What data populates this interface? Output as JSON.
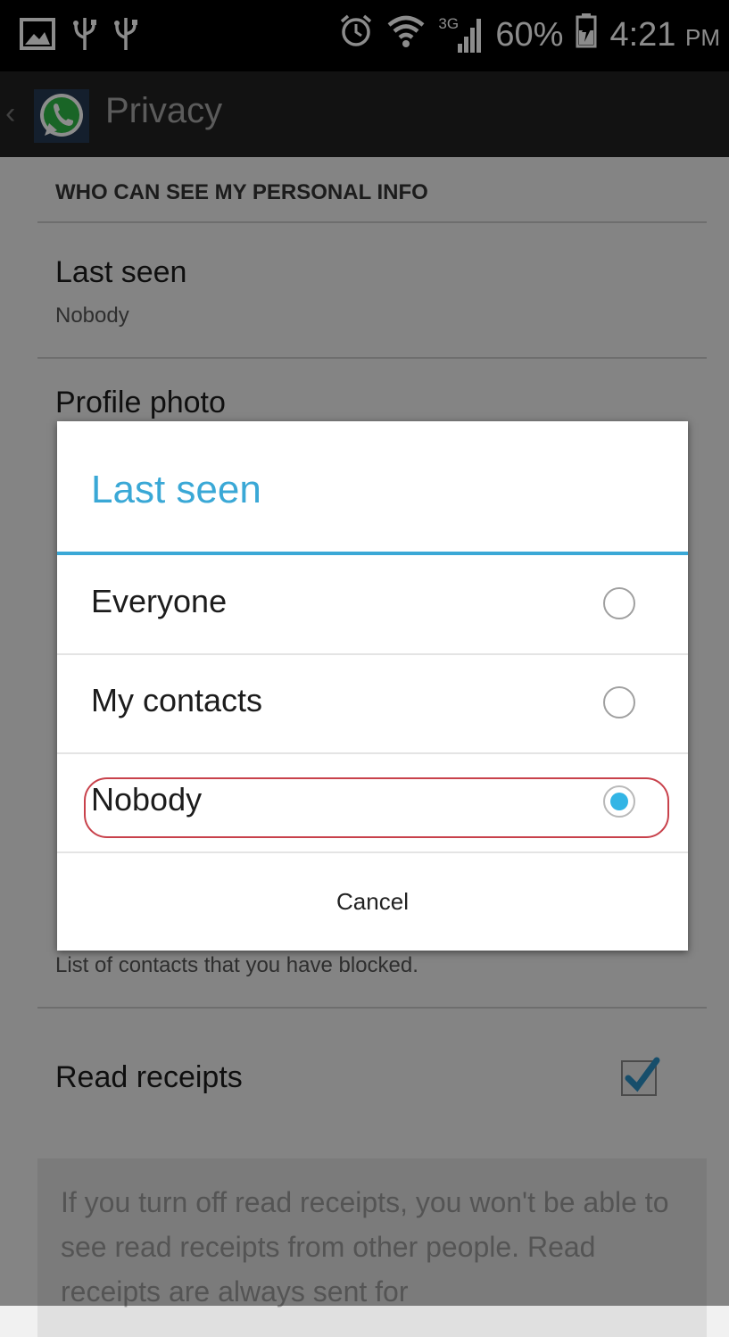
{
  "status_bar": {
    "icons_left": [
      "picture-icon",
      "usb-icon",
      "usb-icon"
    ],
    "network_type": "3G",
    "battery": "60%",
    "time": "4:21",
    "ampm": "PM"
  },
  "action_bar": {
    "title": "Privacy",
    "icon": "whatsapp-logo"
  },
  "settings": {
    "section_header": "WHO CAN SEE MY PERSONAL INFO",
    "last_seen": {
      "title": "Last seen",
      "value": "Nobody"
    },
    "profile_photo": {
      "title": "Profile photo"
    },
    "blocked_contacts": {
      "subtitle": "List of contacts that you have blocked."
    },
    "read_receipts": {
      "title": "Read receipts",
      "checked": true
    },
    "read_receipts_note": "If you turn off read receipts, you won't be able to see read receipts from other people. Read receipts are always sent for"
  },
  "dialog": {
    "title": "Last seen",
    "options": [
      {
        "label": "Everyone",
        "selected": false
      },
      {
        "label": "My contacts",
        "selected": false
      },
      {
        "label": "Nobody",
        "selected": true
      }
    ],
    "cancel_label": "Cancel"
  },
  "colors": {
    "accent": "#33b5e5",
    "dialog_title": "#3aa8d6",
    "annotation_outline": "#c8414b",
    "whatsapp_green": "#2fb945"
  }
}
